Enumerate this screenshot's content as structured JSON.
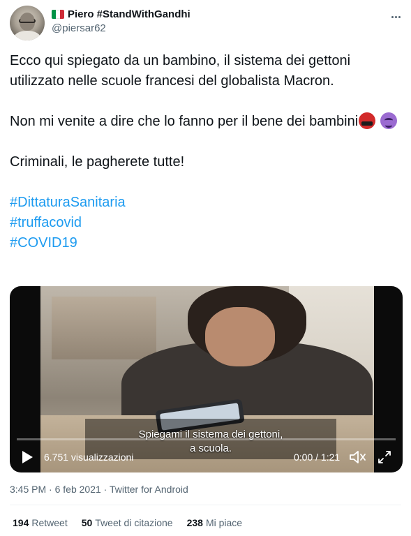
{
  "user": {
    "display_name": "Piero #StandWithGandhi",
    "handle": "@piersar62"
  },
  "tweet": {
    "paragraphs": [
      "Ecco qui spiegato da un bambino, il sistema dei gettoni utilizzato nelle scuole francesi del globalista Macron.",
      "Non mi venite a dire che lo fanno per il bene dei bambini",
      "Criminali, le pagherete tutte!"
    ],
    "emojis": [
      "face-with-symbols-on-mouth",
      "smiling-face-with-horns"
    ],
    "hashtags": [
      "#DittaturaSanitaria",
      "#truffacovid",
      "#COVID19"
    ]
  },
  "video": {
    "subtitle_line1": "Spiegami il sistema dei gettoni,",
    "subtitle_line2": "a scuola.",
    "views": "6.751 visualizzazioni",
    "time": "0:00 / 1:21",
    "progress": 0
  },
  "meta": {
    "time": "3:45 PM",
    "date": "6 feb 2021",
    "source": "Twitter for Android"
  },
  "stats": {
    "retweets_count": "194",
    "retweets_label": "Retweet",
    "quotes_count": "50",
    "quotes_label": "Tweet di citazione",
    "likes_count": "238",
    "likes_label": "Mi piace"
  },
  "colors": {
    "accent": "#1d9bf0",
    "text": "#0f1419",
    "muted": "#536471",
    "flag_green": "#009246",
    "flag_white": "#ffffff",
    "flag_red": "#ce2b37"
  },
  "icons": [
    "more-icon",
    "play-icon",
    "volume-icon",
    "fullscreen-icon"
  ]
}
